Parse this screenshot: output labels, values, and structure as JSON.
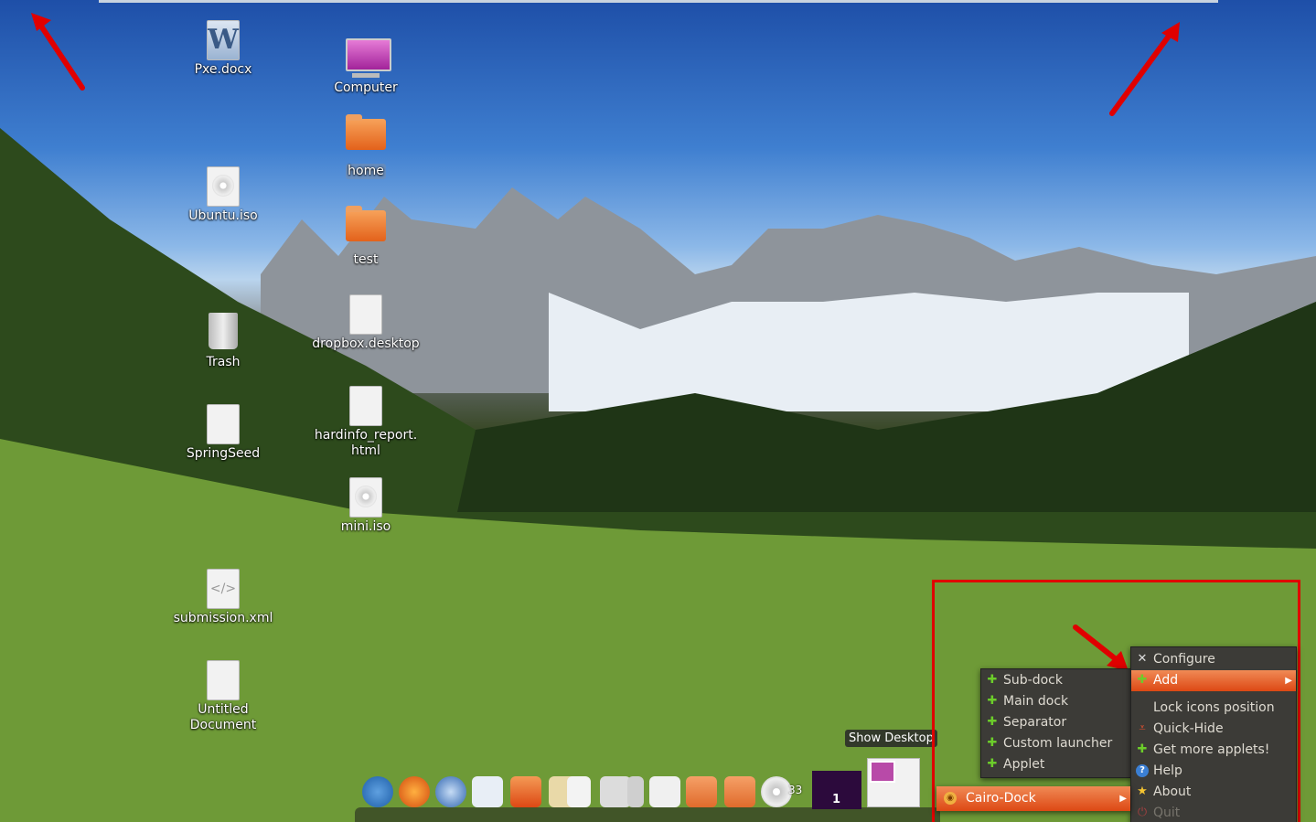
{
  "desktop": {
    "icons": [
      {
        "label": "Pxe.docx",
        "type": "word-doc-icon"
      },
      {
        "label": "Computer",
        "type": "computer-icon"
      },
      {
        "label": "home",
        "type": "home-folder-icon"
      },
      {
        "label": "Ubuntu.iso",
        "type": "disc-image-icon"
      },
      {
        "label": "test",
        "type": "folder-icon"
      },
      {
        "label": "dropbox.desktop",
        "type": "text-file-icon"
      },
      {
        "label": "Trash",
        "type": "trash-icon"
      },
      {
        "label": "hardinfo_report.\nhtml",
        "type": "html-file-icon"
      },
      {
        "label": "SpringSeed",
        "type": "blank-file-icon"
      },
      {
        "label": "mini.iso",
        "type": "disc-image-icon"
      },
      {
        "label": "submission.xml",
        "type": "xml-file-icon"
      },
      {
        "label": "Untitled Document",
        "type": "text-file-icon"
      }
    ]
  },
  "context_menu": {
    "items": [
      {
        "label": "Configure",
        "icon": "configure-icon"
      },
      {
        "label": "Add",
        "icon": "plus-icon",
        "has_submenu": true,
        "active": true
      },
      {
        "label": "Lock icons position",
        "icon": "none"
      },
      {
        "label": "Quick-Hide",
        "icon": "quick-hide-icon"
      },
      {
        "label": "Get more applets!",
        "icon": "plus-icon"
      },
      {
        "label": "Help",
        "icon": "help-icon"
      },
      {
        "label": "About",
        "icon": "star-icon"
      },
      {
        "label": "Quit",
        "icon": "quit-icon",
        "disabled": true
      }
    ]
  },
  "add_submenu": {
    "items": [
      {
        "label": "Sub-dock",
        "icon": "plus-icon"
      },
      {
        "label": "Main dock",
        "icon": "plus-icon"
      },
      {
        "label": "Separator",
        "icon": "plus-icon"
      },
      {
        "label": "Custom launcher",
        "icon": "plus-icon"
      },
      {
        "label": "Applet",
        "icon": "plus-icon"
      }
    ]
  },
  "cairo_dock_item": {
    "label": "Cairo-Dock",
    "icon": "cairo-dock-icon"
  },
  "dock": {
    "tooltip": "Show Desktop",
    "workspace_number": "1",
    "disc_count": "33",
    "icons": [
      "accessibility-icon",
      "firefox-icon",
      "thunderbird-icon",
      "chat-icon",
      "software-center-icon",
      "files-icon",
      "presentation-icon",
      "calculator-icon",
      "upload-icon",
      "text-editor-icon",
      "backup-icon",
      "downloads-icon",
      "disc-icon"
    ]
  },
  "colors": {
    "accent": "#dd4814",
    "highlight_frame": "#e00000",
    "menu_bg": "#3c3b37"
  }
}
